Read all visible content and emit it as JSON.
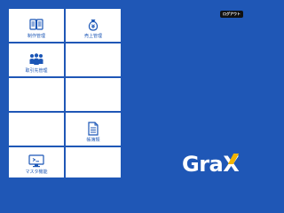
{
  "header": {
    "logout_label": "ログアウト"
  },
  "tiles": [
    {
      "label": "制作管理",
      "icon": "book-icon"
    },
    {
      "label": "売上管理",
      "icon": "money-bag-icon"
    },
    {
      "label": "取引先管理",
      "icon": "people-icon"
    },
    {
      "label": "",
      "icon": ""
    },
    {
      "label": "",
      "icon": ""
    },
    {
      "label": "",
      "icon": ""
    },
    {
      "label": "",
      "icon": ""
    },
    {
      "label": "",
      "icon": ""
    },
    {
      "label": "",
      "icon": ""
    },
    {
      "label": "帳簿類",
      "icon": "document-icon"
    },
    {
      "label": "マスタ機能",
      "icon": "monitor-icon"
    },
    {
      "label": "",
      "icon": ""
    }
  ],
  "branding": {
    "logo_text": "GraX",
    "accent_color": "#f2b400",
    "background_color": "#1f57b6"
  }
}
